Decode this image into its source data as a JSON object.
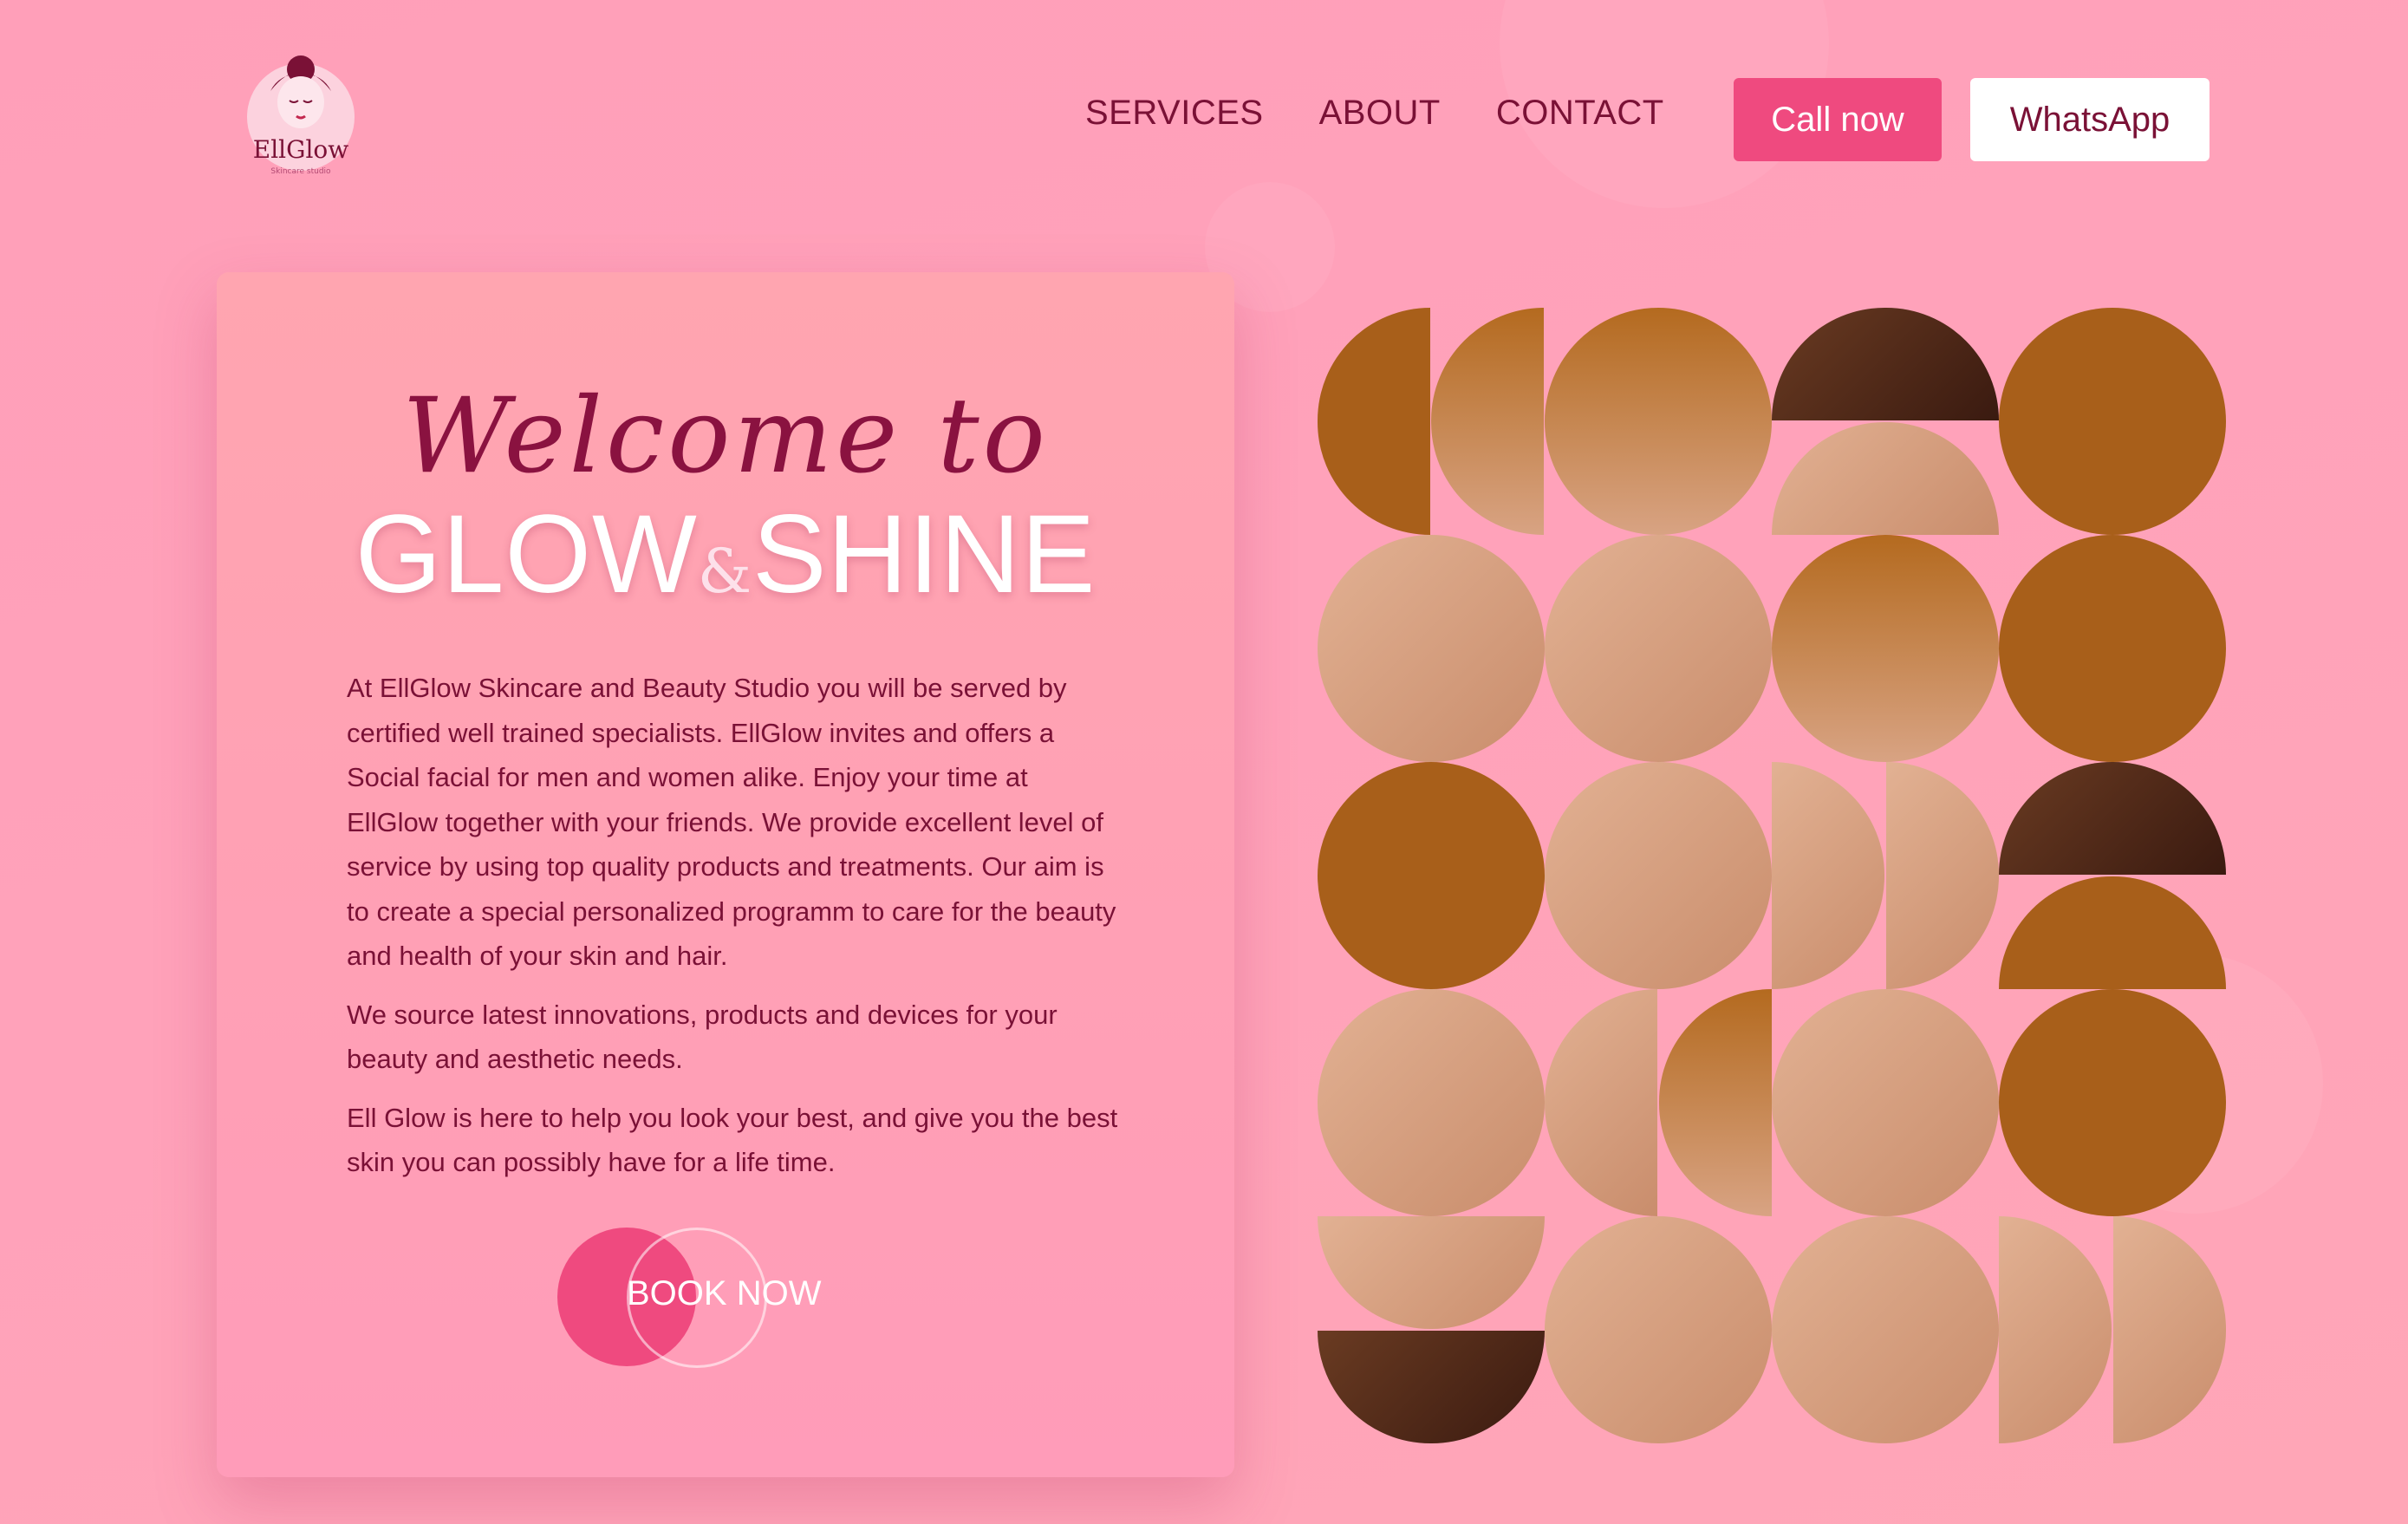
{
  "brand": {
    "logo_text": "EllGlow",
    "logo_tagline": "Skincare studio"
  },
  "nav": {
    "services": "SERVICES",
    "about": "ABOUT",
    "contact": "CONTACT"
  },
  "actions": {
    "call": "Call now",
    "whatsapp": "WhatsApp"
  },
  "hero": {
    "welcome": "Welcome to",
    "title_left": "GLOW",
    "title_amp": "&",
    "title_right": "SHINE",
    "paragraphs": [
      "At EllGlow Skincare and Beauty Studio you will be served by certified well trained specialists. EllGlow invites and offers a Social facial for men and women alike. Enjoy your time at EllGlow together with your friends. We provide excellent level of service by using top quality products and treatments. Our aim is to create a special personalized programm to care for the beauty and health of your skin and hair.",
      "We source latest innovations, products and devices for your beauty and aesthetic needs.",
      "Ell Glow is here to help you look your best, and give you the best skin you can possibly have for a life time."
    ],
    "book_label": "BOOK NOW"
  },
  "colors": {
    "accent": "#ef4a7f",
    "text": "#7a1136",
    "ochre": "#a85f1a"
  }
}
